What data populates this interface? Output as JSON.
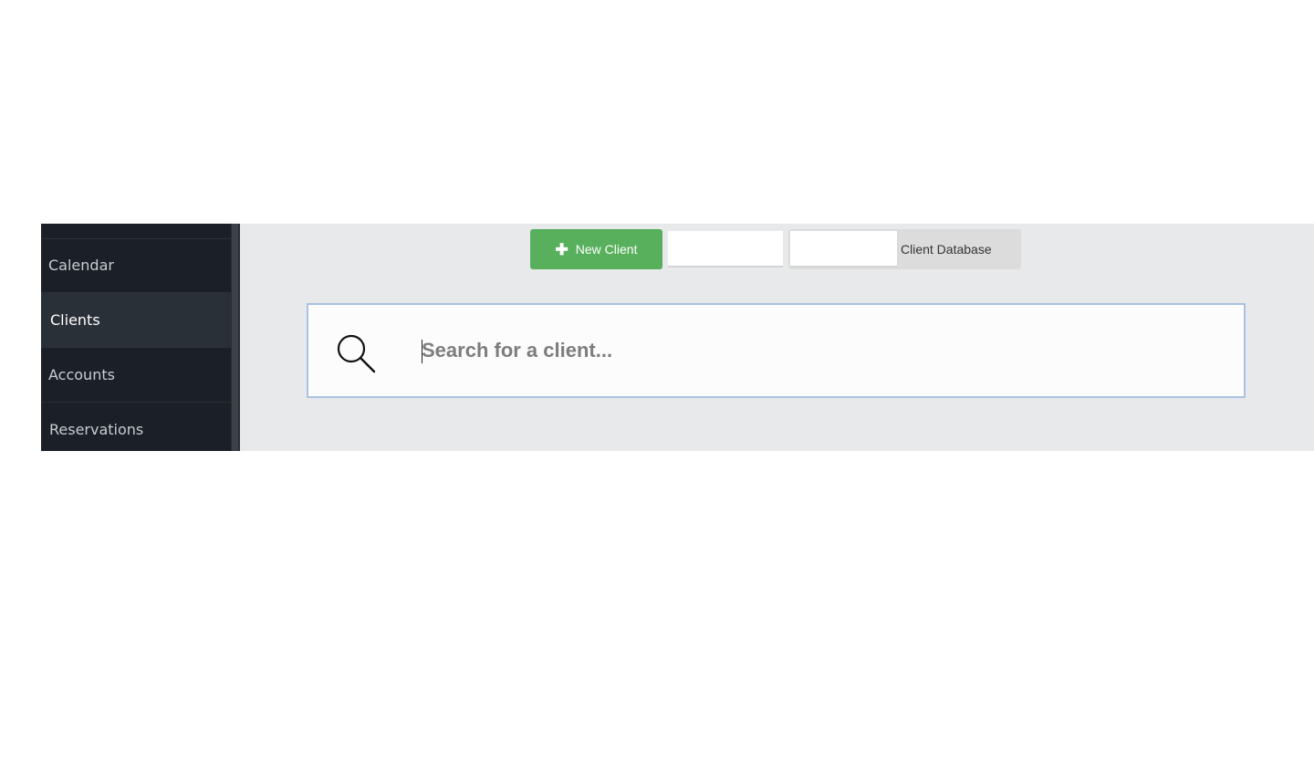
{
  "sidebar": {
    "items": [
      {
        "label": "Calendar"
      },
      {
        "label": "Clients",
        "active": true
      },
      {
        "label": "Accounts"
      },
      {
        "label": "Reservations"
      }
    ]
  },
  "toolbar": {
    "new_client_label": "New Client",
    "tabs": [
      {
        "label": ""
      },
      {
        "label": "Client Database"
      }
    ]
  },
  "search": {
    "placeholder": "Search for a client...",
    "value": "",
    "icon": "search-icon"
  },
  "colors": {
    "sidebar_bg": "#1b1f27",
    "sidebar_active_bg": "#2a3037",
    "main_bg": "#e8e9ea",
    "new_button": "#58b05d",
    "search_border": "#a9c2e6"
  }
}
